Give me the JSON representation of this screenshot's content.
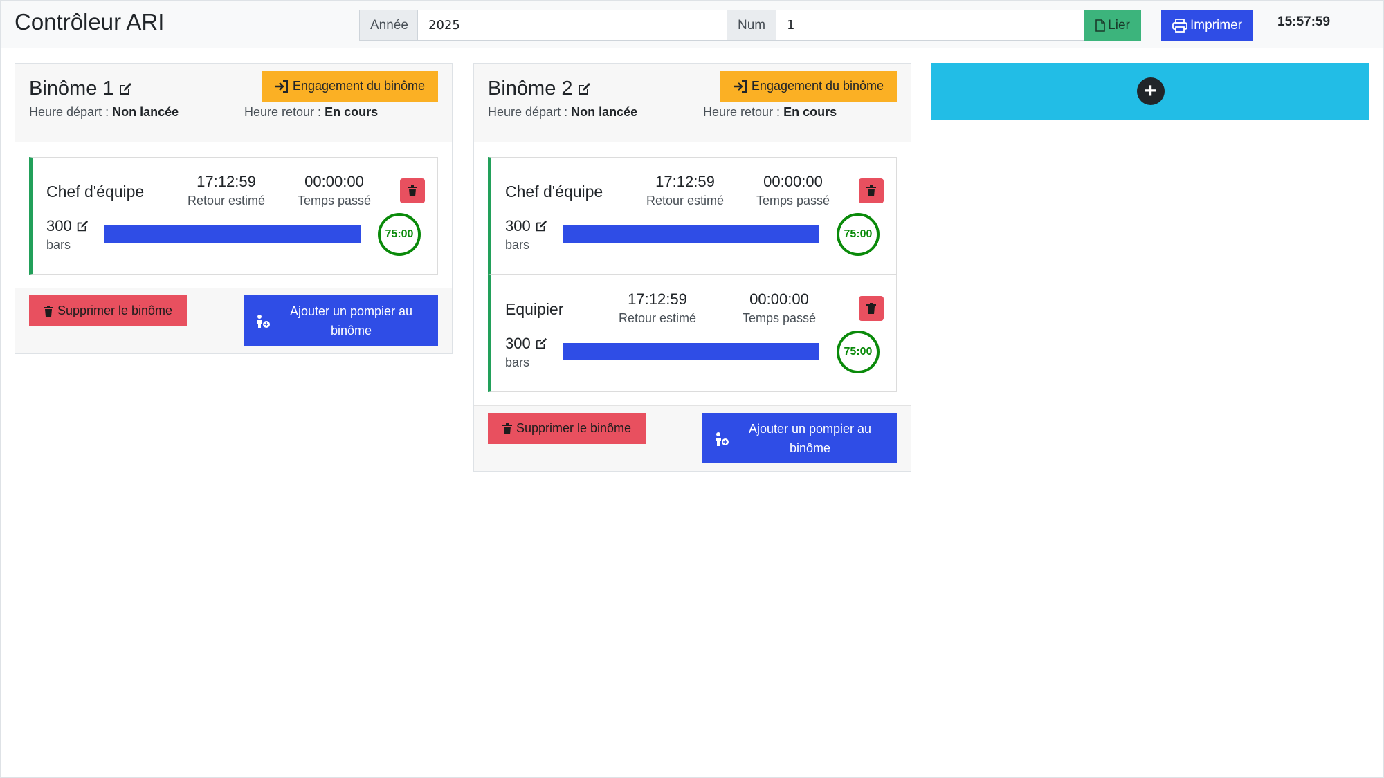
{
  "header": {
    "title": "Contrôleur ARI",
    "year_label": "Année",
    "year_value": "2025",
    "num_label": "Num",
    "num_value": "1",
    "link_button": "Lier",
    "print_button": "Imprimer",
    "clock": "15:57:59"
  },
  "binomes": [
    {
      "title": "Binôme 1",
      "engage_button": "Engagement du binôme",
      "depart_label": "Heure départ :",
      "depart_value": "Non lancée",
      "retour_label": "Heure retour :",
      "retour_value": "En cours",
      "delete_button": "Supprimer le binôme",
      "add_button": "Ajouter un pompier au binôme",
      "members": [
        {
          "role": "Chef d'équipe",
          "retour_estime": "17:12:59",
          "retour_estime_label": "Retour estimé",
          "temps_passe": "00:00:00",
          "temps_passe_label": "Temps passé",
          "pressure": "300",
          "unit": "bars",
          "pressure_fraction": 1.0,
          "timer": "75:00"
        }
      ]
    },
    {
      "title": "Binôme 2",
      "engage_button": "Engagement du binôme",
      "depart_label": "Heure départ :",
      "depart_value": "Non lancée",
      "retour_label": "Heure retour :",
      "retour_value": "En cours",
      "delete_button": "Supprimer le binôme",
      "add_button": "Ajouter un pompier au binôme",
      "members": [
        {
          "role": "Chef d'équipe",
          "retour_estime": "17:12:59",
          "retour_estime_label": "Retour estimé",
          "temps_passe": "00:00:00",
          "temps_passe_label": "Temps passé",
          "pressure": "300",
          "unit": "bars",
          "pressure_fraction": 1.0,
          "timer": "75:00"
        },
        {
          "role": "Equipier",
          "retour_estime": "17:12:59",
          "retour_estime_label": "Retour estimé",
          "temps_passe": "00:00:00",
          "temps_passe_label": "Temps passé",
          "pressure": "300",
          "unit": "bars",
          "pressure_fraction": 1.0,
          "timer": "75:00"
        }
      ]
    }
  ],
  "icons": {
    "edit": "edit-icon",
    "trash": "trash-icon",
    "sign_in": "sign-in-icon",
    "file": "file-icon",
    "print": "print-icon",
    "user_plus": "user-plus-icon",
    "plus": "plus-icon"
  },
  "colors": {
    "success": "#3cb47c",
    "primary": "#2f4de6",
    "warning": "#fbb024",
    "danger": "#e8505f",
    "info": "#22bde6",
    "timer": "#0a8a0a",
    "member_border": "#22a05a"
  }
}
